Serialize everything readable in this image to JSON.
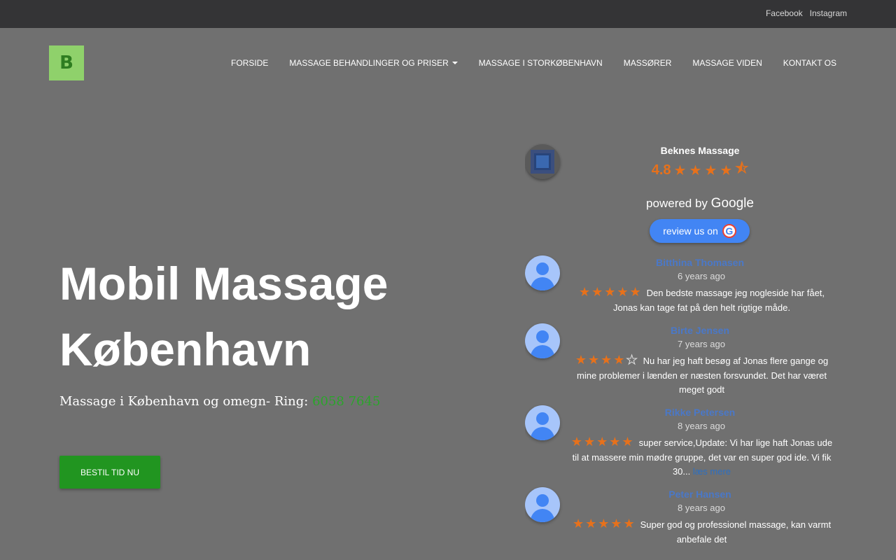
{
  "topbar": {
    "social": [
      "Facebook",
      "Instagram"
    ]
  },
  "logo": {
    "letter": "B"
  },
  "nav": {
    "items": [
      {
        "label": "FORSIDE"
      },
      {
        "label": "MASSAGE BEHANDLINGER OG PRISER"
      },
      {
        "label": "MASSAGE I STORKØBENHAVN"
      },
      {
        "label": "MASSØRER"
      },
      {
        "label": "MASSAGE VIDEN"
      },
      {
        "label": "KONTAKT OS"
      }
    ]
  },
  "hero": {
    "title_line1": "Mobil Massage",
    "title_line2": "København",
    "subtitle": "Massage i København og omegn- Ring: ",
    "phone": "6058 7645",
    "cta": "BESTIL TID NU",
    "colors": {
      "cta": "#219520",
      "phone": "#2aa52a"
    }
  },
  "reviews_widget": {
    "business_name": "Beknes Massage",
    "rating": "4.8",
    "powered_prefix": "powered by",
    "powered_brand": "Google",
    "review_button": "review us on",
    "reviews": [
      {
        "name": "Bitthina Thomasen",
        "time": "6 years ago",
        "stars": 5,
        "text": "Den bedste massage jeg nogleside har fået, Jonas kan tage fat på den helt rigtige måde.",
        "more": ""
      },
      {
        "name": "Birte Jensen",
        "time": "7 years ago",
        "stars": 4,
        "text": "Nu har  jeg haft besøg af Jonas flere gange og mine problemer i lænden er næsten forsvundet. Det har været meget godt",
        "more": ""
      },
      {
        "name": "Rikke Petersen",
        "time": "8 years ago",
        "stars": 5,
        "text": "super service,Update: Vi har lige haft Jonas ude til at massere min mødre gruppe, det var en super god ide. Vi fik 30...",
        "more": "læs mere"
      },
      {
        "name": "Peter Hansen",
        "time": "8 years ago",
        "stars": 5,
        "text": "Super god og professionel massage, kan varmt anbefale det",
        "more": ""
      }
    ],
    "colors": {
      "star": "#e7711b",
      "button": "#4285f4",
      "name": "#4a78c8"
    }
  }
}
